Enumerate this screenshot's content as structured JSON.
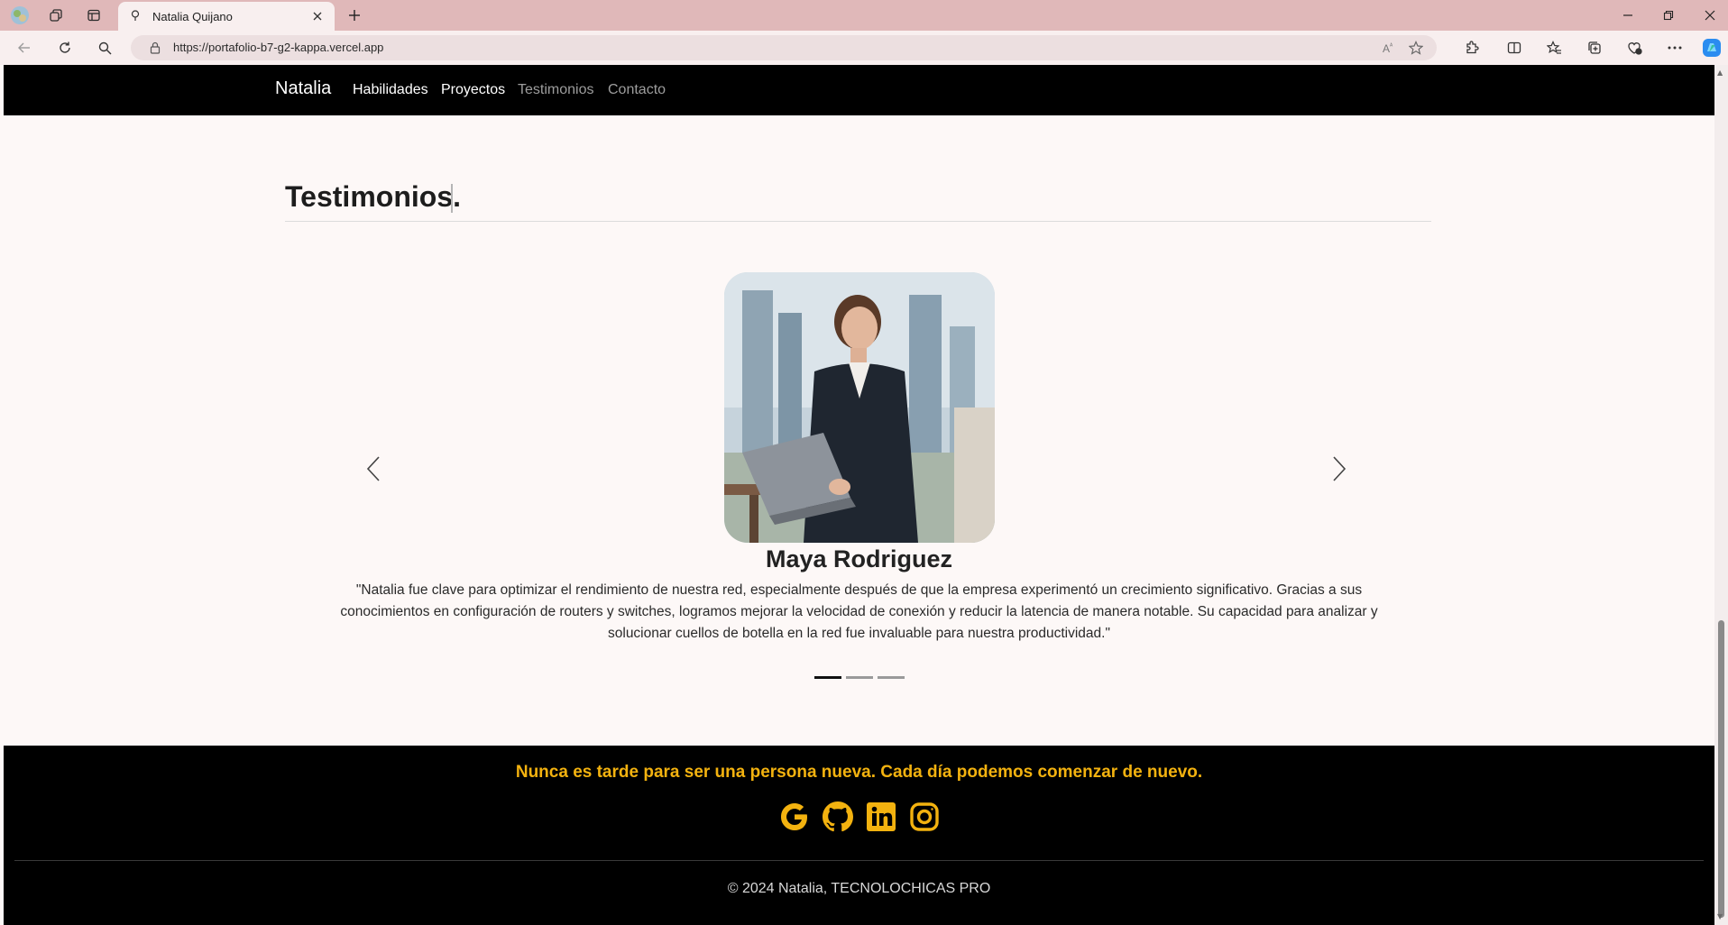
{
  "browser": {
    "tab_title": "Natalia Quijano",
    "url": "https://portafolio-b7-g2-kappa.vercel.app"
  },
  "site": {
    "brand": "Natalia",
    "nav": [
      {
        "label": "Habilidades",
        "active": false
      },
      {
        "label": "Proyectos",
        "active": false
      },
      {
        "label": "Testimonios",
        "active": true
      },
      {
        "label": "Contacto",
        "active": true
      }
    ]
  },
  "testimonials": {
    "title": "Testimonios.",
    "current": {
      "name": "Maya Rodriguez",
      "quote": "\"Natalia fue clave para optimizar el rendimiento de nuestra red, especialmente después de que la empresa experimentó un crecimiento significativo. Gracias a sus conocimientos en configuración de routers y switches, logramos mejorar la velocidad de conexión y reducir la latencia de manera notable. Su capacidad para analizar y solucionar cuellos de botella en la red fue invaluable para nuestra productividad.\""
    },
    "slide_count": 3,
    "active_slide": 1
  },
  "footer": {
    "motto": "Nunca es tarde para ser una persona nueva. Cada día podemos comenzar de nuevo.",
    "social_icons": [
      "google-icon",
      "github-icon",
      "linkedin-icon",
      "instagram-icon"
    ],
    "copyright": "© 2024 Natalia, TECNOLOCHICAS PRO"
  },
  "colors": {
    "accent": "#f3b20f",
    "navbar_bg": "#000000",
    "titlebar": "#e0b8b9"
  }
}
